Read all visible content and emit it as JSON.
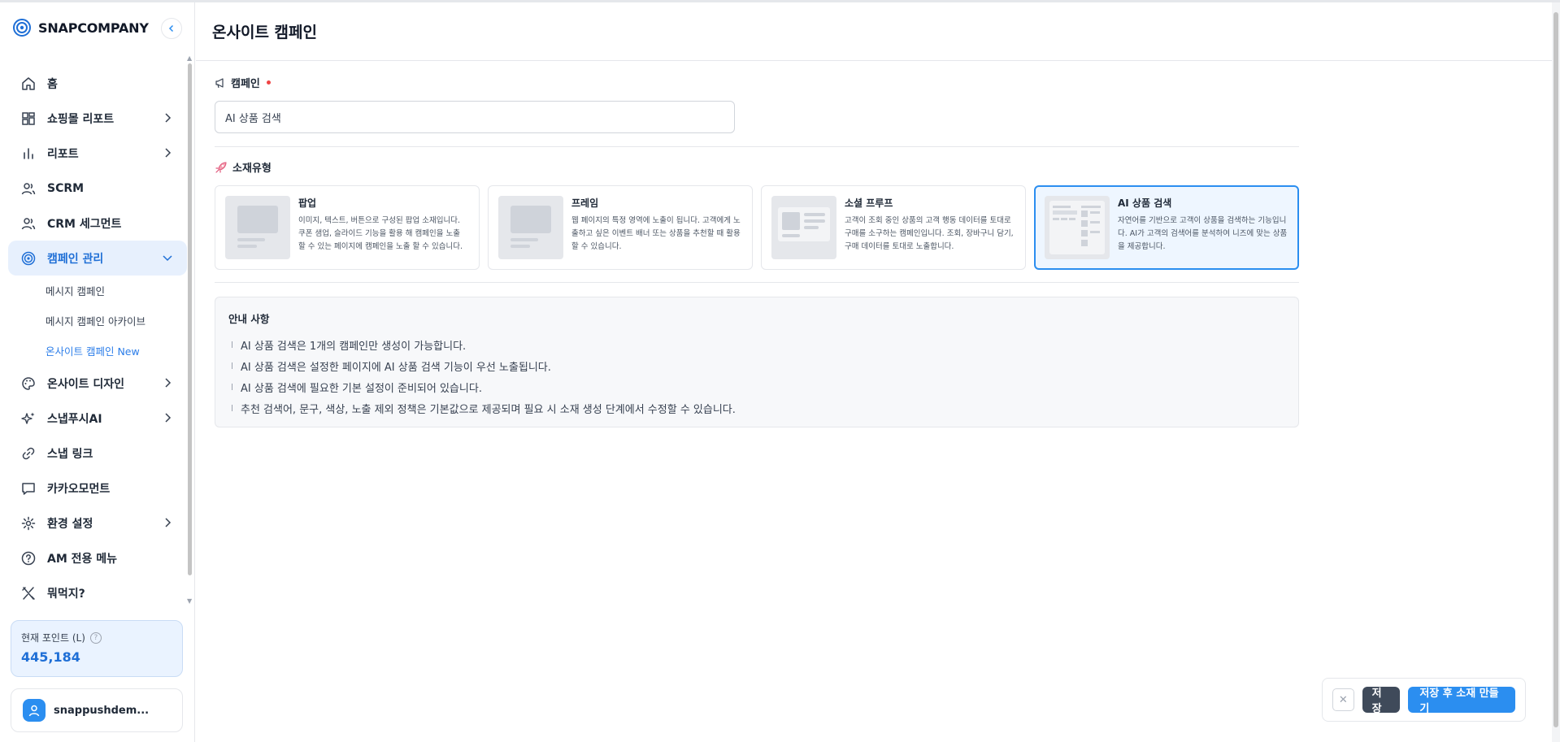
{
  "brand": {
    "name": "SNAPCOMPANY"
  },
  "sidebar": {
    "items": [
      {
        "label": "홈",
        "icon": "home-icon"
      },
      {
        "label": "쇼핑몰 리포트",
        "icon": "dashboard-icon",
        "has_chevron": true
      },
      {
        "label": "리포트",
        "icon": "bar-chart-icon",
        "has_chevron": true
      },
      {
        "label": "SCRM",
        "icon": "users-icon"
      },
      {
        "label": "CRM 세그먼트",
        "icon": "users-icon"
      },
      {
        "label": "캠페인 관리",
        "icon": "target-icon",
        "active": true,
        "expanded": true
      },
      {
        "label": "온사이트 디자인",
        "icon": "palette-icon",
        "has_chevron": true
      },
      {
        "label": "스냅푸시AI",
        "icon": "sparkles-icon",
        "has_chevron": true
      },
      {
        "label": "스냅 링크",
        "icon": "link-icon"
      },
      {
        "label": "카카오모먼트",
        "icon": "chat-icon"
      },
      {
        "label": "환경 설정",
        "icon": "gear-icon",
        "has_chevron": true
      },
      {
        "label": "AM 전용 메뉴",
        "icon": "question-icon"
      },
      {
        "label": "뭐먹지?",
        "icon": "utensils-icon"
      }
    ],
    "sub_items": [
      {
        "label": "메시지 캠페인"
      },
      {
        "label": "메시지 캠페인 아카이브"
      },
      {
        "label": "온사이트 캠페인 New",
        "active": true
      }
    ],
    "points": {
      "label": "현재 포인트 (L)",
      "value": "445,184"
    },
    "user": {
      "name": "snappushdem..."
    }
  },
  "main": {
    "title": "온사이트 캠페인",
    "campaign_label": "캠페인",
    "campaign_value": "AI 상품 검색",
    "material_label": "소재유형",
    "cards": [
      {
        "title": "팝업",
        "desc": "이미지, 텍스트, 버튼으로 구성된 팝업 소재입니다. 쿠폰 샘업, 슬라이드 기능을 활용 해 캠페인을 노출 할 수 있는 페이지에 캠페인을 노출 할 수 있습니다."
      },
      {
        "title": "프레임",
        "desc": "웹 페이지의 특정 영역에 노출이 됩니다. 고객에게 노출하고 싶은 이벤트 배너 또는 상품을 추천할 때 활용할 수 있습니다."
      },
      {
        "title": "소셜 프루프",
        "desc": "고객이 조회 중인 상품의 고객 행동 데이터를 토대로 구매를 소구하는 캠페인입니다. 조회, 장바구니 담기, 구매 데이터를 토대로 노출합니다."
      },
      {
        "title": "AI 상품 검색",
        "desc": "자연어를 기반으로 고객이 상품을 검색하는 기능입니다. AI가 고객의 검색어를 분석하여 니즈에 맞는 상품을 제공합니다.",
        "selected": true
      }
    ],
    "notice": {
      "title": "안내 사항",
      "items": [
        "AI 상품 검색은 1개의 캠페인만 생성이 가능합니다.",
        "AI 상품 검색은 설정한 페이지에 AI 상품 검색 기능이 우선 노출됩니다.",
        "AI 상품 검색에 필요한 기본 설정이 준비되어 있습니다.",
        "추천 검색어, 문구, 색상, 노출 제외 정책은 기본값으로 제공되며 필요 시 소재 생성 단계에서 수정할 수 있습니다."
      ]
    }
  },
  "actions": {
    "close": "✕",
    "save": "저장",
    "save_and_create": "저장 후 소재 만들기"
  },
  "colors": {
    "accent": "#2b8ef0",
    "active_bg": "#e7f0fd",
    "dark_button": "#3f4a5a"
  }
}
